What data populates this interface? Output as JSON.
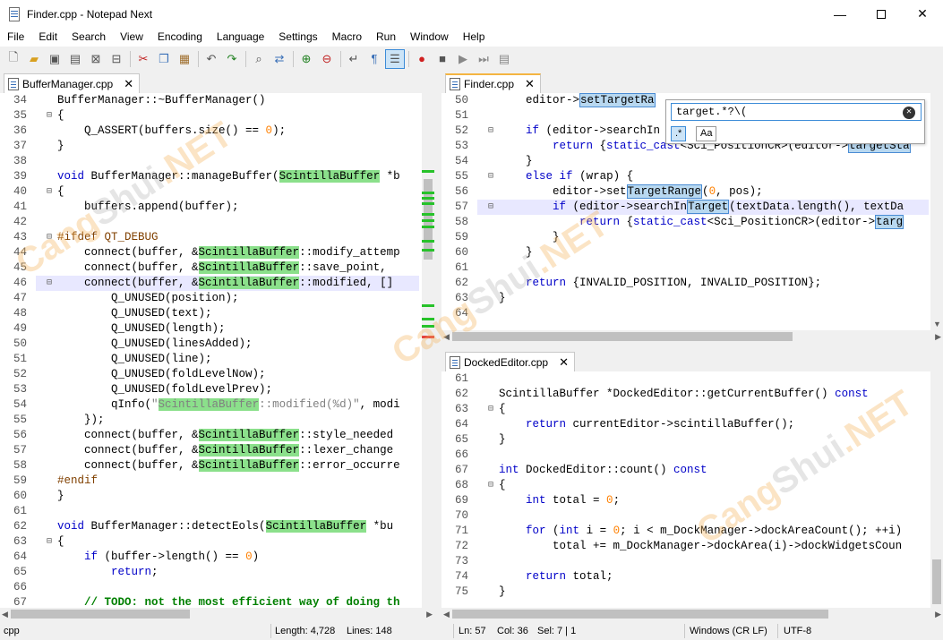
{
  "window": {
    "title": "Finder.cpp - Notepad Next"
  },
  "menu": [
    "File",
    "Edit",
    "Search",
    "View",
    "Encoding",
    "Language",
    "Settings",
    "Macro",
    "Run",
    "Window",
    "Help"
  ],
  "toolbar": {
    "icons": [
      "new-file-icon",
      "open-file-icon",
      "save-icon",
      "save-all-icon",
      "close-icon",
      "close-all-icon",
      "cut-icon",
      "copy-icon",
      "paste-icon",
      "undo-icon",
      "redo-icon",
      "find-icon",
      "replace-icon",
      "zoom-in-icon",
      "zoom-out-icon",
      "word-wrap-icon",
      "show-all-chars-icon",
      "indent-guide-icon",
      "record-macro-icon",
      "stop-macro-icon",
      "play-macro-icon",
      "run-macro-multiple-icon"
    ]
  },
  "left_pane": {
    "tab": "BufferManager.cpp",
    "lines": [
      {
        "n": "34",
        "f": "",
        "c": "    BufferManager::~BufferManager()"
      },
      {
        "n": "35",
        "f": "⊟",
        "c": "    {"
      },
      {
        "n": "36",
        "f": "",
        "c": "        Q_ASSERT(buffers.size() == 0);"
      },
      {
        "n": "37",
        "f": "",
        "c": "    }"
      },
      {
        "n": "38",
        "f": "",
        "c": ""
      },
      {
        "n": "39",
        "f": "",
        "c": "    void BufferManager::manageBuffer(ScintillaBuffer *b"
      },
      {
        "n": "40",
        "f": "⊟",
        "c": "    {"
      },
      {
        "n": "41",
        "f": "",
        "c": "        buffers.append(buffer);"
      },
      {
        "n": "42",
        "f": "",
        "c": ""
      },
      {
        "n": "43",
        "f": "⊟",
        "c": "    #ifdef QT_DEBUG"
      },
      {
        "n": "44",
        "f": "",
        "c": "        connect(buffer, &ScintillaBuffer::modify_attemp"
      },
      {
        "n": "45",
        "f": "",
        "c": "        connect(buffer, &ScintillaBuffer::save_point, "
      },
      {
        "n": "46",
        "f": "⊟",
        "c": "        connect(buffer, &ScintillaBuffer::modified, [] "
      },
      {
        "n": "47",
        "f": "",
        "c": "            Q_UNUSED(position);"
      },
      {
        "n": "48",
        "f": "",
        "c": "            Q_UNUSED(text);"
      },
      {
        "n": "49",
        "f": "",
        "c": "            Q_UNUSED(length);"
      },
      {
        "n": "50",
        "f": "",
        "c": "            Q_UNUSED(linesAdded);"
      },
      {
        "n": "51",
        "f": "",
        "c": "            Q_UNUSED(line);"
      },
      {
        "n": "52",
        "f": "",
        "c": "            Q_UNUSED(foldLevelNow);"
      },
      {
        "n": "53",
        "f": "",
        "c": "            Q_UNUSED(foldLevelPrev);"
      },
      {
        "n": "54",
        "f": "",
        "c": "            qInfo(\"ScintillaBuffer::modified(%d)\", modi"
      },
      {
        "n": "55",
        "f": "",
        "c": "        });"
      },
      {
        "n": "56",
        "f": "",
        "c": "        connect(buffer, &ScintillaBuffer::style_needed"
      },
      {
        "n": "57",
        "f": "",
        "c": "        connect(buffer, &ScintillaBuffer::lexer_change"
      },
      {
        "n": "58",
        "f": "",
        "c": "        connect(buffer, &ScintillaBuffer::error_occurre"
      },
      {
        "n": "59",
        "f": "",
        "c": "    #endif"
      },
      {
        "n": "60",
        "f": "",
        "c": "    }"
      },
      {
        "n": "61",
        "f": "",
        "c": ""
      },
      {
        "n": "62",
        "f": "",
        "c": "    void BufferManager::detectEols(ScintillaBuffer *bu"
      },
      {
        "n": "63",
        "f": "⊟",
        "c": "    {"
      },
      {
        "n": "64",
        "f": "",
        "c": "        if (buffer->length() == 0)"
      },
      {
        "n": "65",
        "f": "",
        "c": "            return;"
      },
      {
        "n": "66",
        "f": "",
        "c": ""
      },
      {
        "n": "67",
        "f": "",
        "c": "        // TODO: not the most efficient way of doing th"
      }
    ]
  },
  "top_right_pane": {
    "tab": "Finder.cpp",
    "lines": [
      {
        "n": "50",
        "f": "",
        "c": "        editor->setTargetRa"
      },
      {
        "n": "51",
        "f": "",
        "c": ""
      },
      {
        "n": "52",
        "f": "⊟",
        "c": "        if (editor->searchIn"
      },
      {
        "n": "53",
        "f": "",
        "c": "            return {static_cast<Sci_PositionCR>(editor->targetSta"
      },
      {
        "n": "54",
        "f": "",
        "c": "        }"
      },
      {
        "n": "55",
        "f": "⊟",
        "c": "        else if (wrap) {"
      },
      {
        "n": "56",
        "f": "",
        "c": "            editor->setTargetRange(0, pos);"
      },
      {
        "n": "57",
        "f": "⊟",
        "c": "            if (editor->searchInTarget(textData.length(), textDa"
      },
      {
        "n": "58",
        "f": "",
        "c": "                return {static_cast<Sci_PositionCR>(editor->targ"
      },
      {
        "n": "59",
        "f": "",
        "c": "            }"
      },
      {
        "n": "60",
        "f": "",
        "c": "        }"
      },
      {
        "n": "61",
        "f": "",
        "c": ""
      },
      {
        "n": "62",
        "f": "",
        "c": "        return {INVALID_POSITION, INVALID_POSITION};"
      },
      {
        "n": "63",
        "f": "",
        "c": "    }"
      },
      {
        "n": "64",
        "f": "",
        "c": ""
      }
    ],
    "find": {
      "query": "target.*?\\(",
      "regex_label": ".*",
      "case_label": "Aa"
    }
  },
  "bottom_right_pane": {
    "tab": "DockedEditor.cpp",
    "lines": [
      {
        "n": "61",
        "f": "",
        "c": ""
      },
      {
        "n": "62",
        "f": "",
        "c": "    ScintillaBuffer *DockedEditor::getCurrentBuffer() const"
      },
      {
        "n": "63",
        "f": "⊟",
        "c": "    {"
      },
      {
        "n": "64",
        "f": "",
        "c": "        return currentEditor->scintillaBuffer();"
      },
      {
        "n": "65",
        "f": "",
        "c": "    }"
      },
      {
        "n": "66",
        "f": "",
        "c": ""
      },
      {
        "n": "67",
        "f": "",
        "c": "    int DockedEditor::count() const"
      },
      {
        "n": "68",
        "f": "⊟",
        "c": "    {"
      },
      {
        "n": "69",
        "f": "",
        "c": "        int total = 0;"
      },
      {
        "n": "70",
        "f": "",
        "c": ""
      },
      {
        "n": "71",
        "f": "",
        "c": "        for (int i = 0; i < m_DockManager->dockAreaCount(); ++i)"
      },
      {
        "n": "72",
        "f": "",
        "c": "            total += m_DockManager->dockArea(i)->dockWidgetsCoun"
      },
      {
        "n": "73",
        "f": "",
        "c": ""
      },
      {
        "n": "74",
        "f": "",
        "c": "        return total;"
      },
      {
        "n": "75",
        "f": "",
        "c": "    }"
      }
    ]
  },
  "status": {
    "language": "cpp",
    "length": "Length: 4,728",
    "lines": "Lines: 148",
    "ln": "Ln: 57",
    "col": "Col: 36",
    "sel": "Sel: 7 | 1",
    "eol": "Windows (CR LF)",
    "encoding": "UTF-8"
  },
  "watermark": {
    "text_a": "Cang",
    "text_b": "Shui",
    "text_c": ".NET"
  },
  "colors": {
    "accent": "#3c8cd8",
    "tab_highlight": "#f4b542",
    "match_green": "#8be08b"
  }
}
